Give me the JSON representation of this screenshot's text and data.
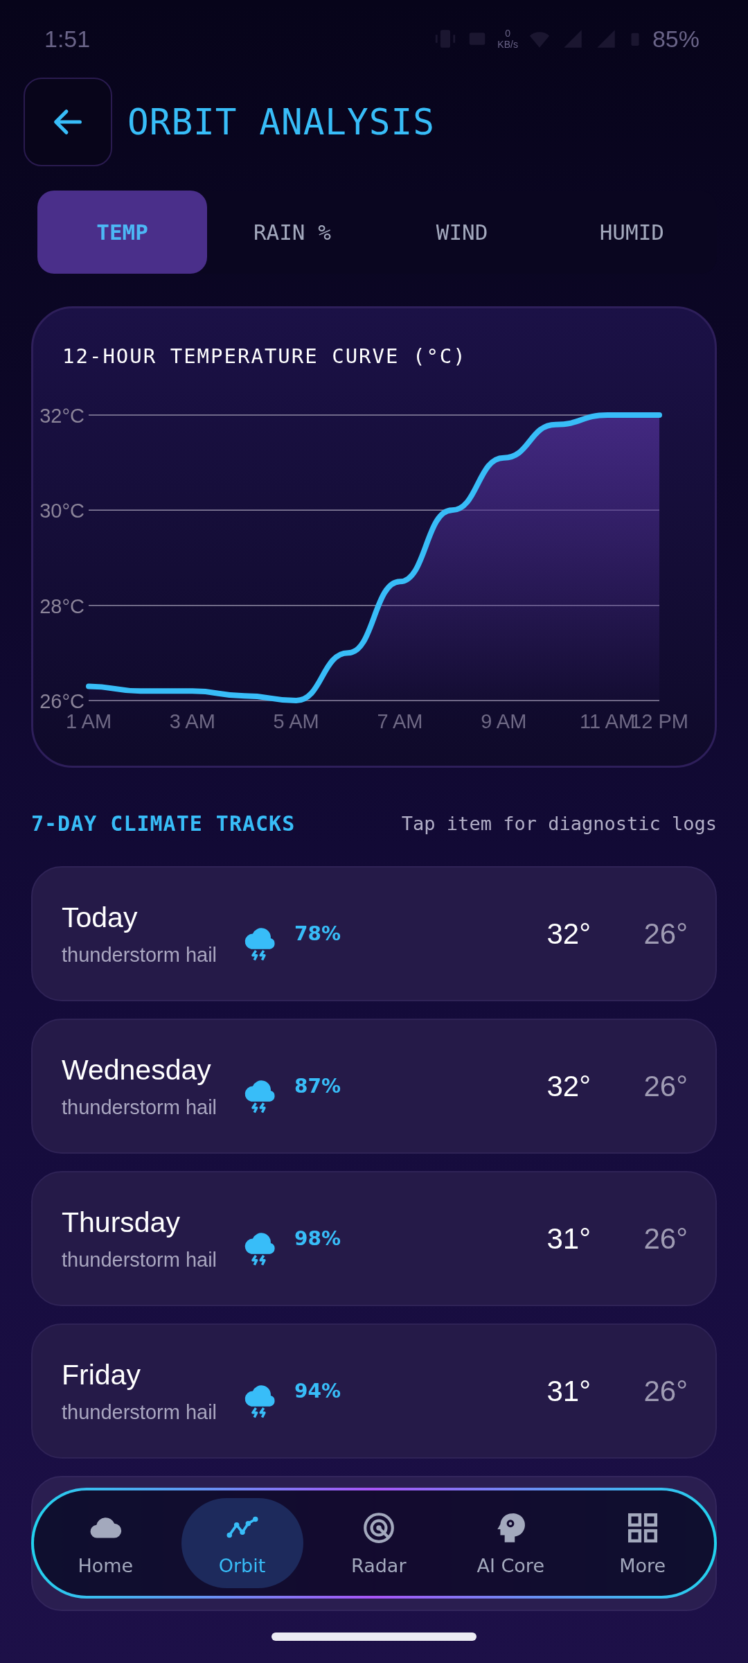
{
  "status_bar": {
    "time": "1:51",
    "speed_value": "0",
    "speed_unit": "KB/s",
    "battery": "85%"
  },
  "header": {
    "title": "ORBIT ANALYSIS"
  },
  "tabs": [
    {
      "label": "TEMP",
      "selected": true
    },
    {
      "label": "RAIN %",
      "selected": false
    },
    {
      "label": "WIND",
      "selected": false
    },
    {
      "label": "HUMID",
      "selected": false
    }
  ],
  "chart_card": {
    "chart_data": {
      "type": "area",
      "title": "12-HOUR TEMPERATURE CURVE (°C)",
      "x": [
        1,
        2,
        3,
        4,
        5,
        6,
        7,
        8,
        9,
        10,
        11,
        12
      ],
      "xlim": [
        1,
        12
      ],
      "series": [
        {
          "color": "#38bdf8",
          "values": [
            26.3,
            26.2,
            26.2,
            26.1,
            26.0,
            27.0,
            28.5,
            30.0,
            31.1,
            31.8,
            32.0,
            32.0
          ]
        }
      ],
      "ylim": [
        26,
        32
      ],
      "yticks": [
        {
          "value": 26,
          "label": "26°C"
        },
        {
          "value": 28,
          "label": "28°C"
        },
        {
          "value": 30,
          "label": "30°C"
        },
        {
          "value": 32,
          "label": "32°C"
        }
      ],
      "xticks": [
        {
          "value": 1,
          "label": "1 AM"
        },
        {
          "value": 3,
          "label": "3 AM"
        },
        {
          "value": 5,
          "label": "5 AM"
        },
        {
          "value": 7,
          "label": "7 AM"
        },
        {
          "value": 9,
          "label": "9 AM"
        },
        {
          "value": 11,
          "label": "11 AM"
        },
        {
          "value": 12,
          "label": "12 PM"
        }
      ]
    }
  },
  "forecast": {
    "title": "7-DAY CLIMATE TRACKS",
    "hint": "Tap item for diagnostic logs",
    "days": [
      {
        "day": "Today",
        "condition": "thunderstorm hail",
        "kind": "storm",
        "precip": "78%",
        "high": "32°",
        "low": "26°"
      },
      {
        "day": "Wednesday",
        "condition": "thunderstorm hail",
        "kind": "storm",
        "precip": "87%",
        "high": "32°",
        "low": "26°"
      },
      {
        "day": "Thursday",
        "condition": "thunderstorm hail",
        "kind": "storm",
        "precip": "98%",
        "high": "31°",
        "low": "26°"
      },
      {
        "day": "Friday",
        "condition": "thunderstorm hail",
        "kind": "storm",
        "precip": "94%",
        "high": "31°",
        "low": "26°"
      }
    ]
  },
  "nav": [
    {
      "label": "Home",
      "kind": "cloud",
      "selected": false
    },
    {
      "label": "Orbit",
      "kind": "chart",
      "selected": true
    },
    {
      "label": "Radar",
      "kind": "radar",
      "selected": false
    },
    {
      "label": "AI Core",
      "kind": "brain",
      "selected": false
    },
    {
      "label": "More",
      "kind": "grid",
      "selected": false
    }
  ]
}
